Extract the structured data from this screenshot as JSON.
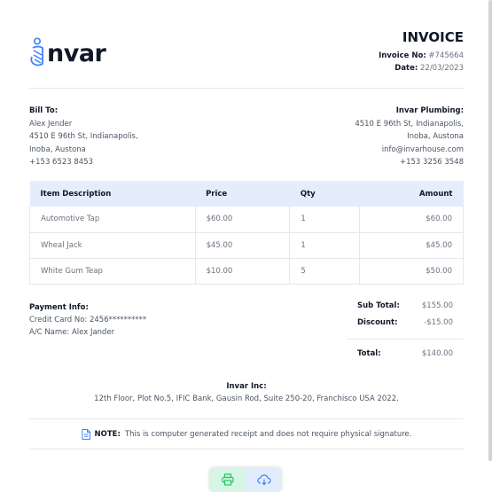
{
  "brand": {
    "name": "nvar",
    "accent": "#3b82f6"
  },
  "invoice": {
    "title": "INVOICE",
    "number_label": "Invoice No:",
    "number": "#745664",
    "date_label": "Date:",
    "date": "22/03/2023"
  },
  "bill_to": {
    "label": "Bill To:",
    "name": "Alex Jender",
    "address1": "4510 E 96th St, Indianapolis,",
    "address2": "Inoba, Austona",
    "phone": "+153 6523 8453"
  },
  "vendor": {
    "name": "Invar Plumbing:",
    "address1": "4510 E 96th St, Indianapolis,",
    "address2": "Inoba, Austona",
    "email": "info@invarhouse.com",
    "phone": "+153 3256 3548"
  },
  "table": {
    "headers": [
      "Item Description",
      "Price",
      "Qty",
      "Amount"
    ],
    "rows": [
      [
        "Automotive Tap",
        "$60.00",
        "1",
        "$60.00"
      ],
      [
        "Wheal Jack",
        "$45.00",
        "1",
        "$45.00"
      ],
      [
        "White Gum Teap",
        "$10.00",
        "5",
        "$50.00"
      ]
    ]
  },
  "payment": {
    "label": "Payment Info:",
    "card": "Credit Card No: 2456**********",
    "ac_name": "A/C Name: Alex Jander"
  },
  "totals": {
    "subtotal_label": "Sub Total:",
    "subtotal": "$155.00",
    "discount_label": "Discount:",
    "discount": "-$15.00",
    "total_label": "Total:",
    "total": "$140.00"
  },
  "company": {
    "name": "Invar Inc:",
    "address": "12th Floor, Plot No.5, IFIC Bank, Gausin Rod, Suite 250-20, Franchisco USA 2022."
  },
  "note": {
    "label": "NOTE:",
    "text": "This is computer generated receipt and does not require physical signature."
  },
  "icons": {
    "print": "printer-icon",
    "download": "cloud-download-icon",
    "note": "document-icon"
  },
  "colors": {
    "print_btn": "#d6f5e6",
    "download_btn": "#e3ecfb",
    "table_header": "#e3edfc"
  }
}
